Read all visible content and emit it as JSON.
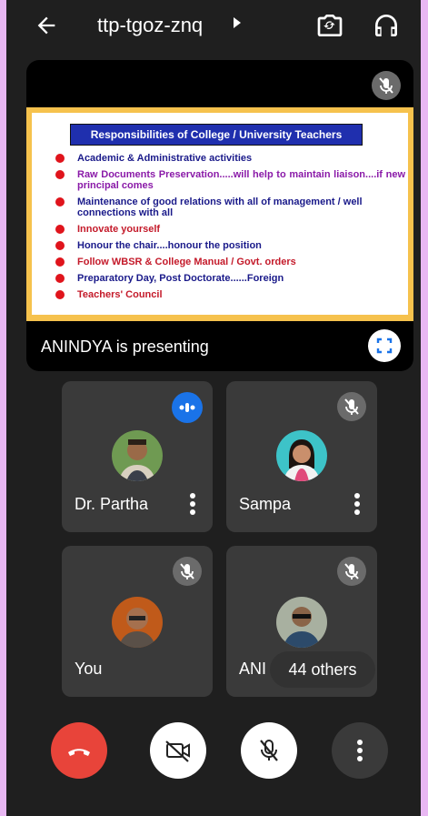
{
  "header": {
    "meeting_code": "ttp-tgoz-znq",
    "icons": [
      "back-arrow-icon",
      "chevron-right-icon",
      "switch-camera-icon",
      "headphones-icon"
    ]
  },
  "presentation": {
    "label": "ANINDYA is presenting",
    "slide": {
      "title": "Responsibilities of College / University Teachers",
      "items": [
        {
          "text": "Academic & Administrative activities",
          "color": "#1a1a8a"
        },
        {
          "text": "Raw   Documents   Preservation.....will   help   to   maintain liaison....if new principal comes",
          "color": "#8a1aa8"
        },
        {
          "text": "Maintenance of good relations with all of management / well connections with all",
          "color": "#1a1a8a"
        },
        {
          "text": "Innovate yourself",
          "color": "#c41a2a"
        },
        {
          "text": "Honour the chair....honour the position",
          "color": "#1a1a8a"
        },
        {
          "text": "Follow WBSR & College Manual / Govt. orders",
          "color": "#c41a2a"
        },
        {
          "text": "Preparatory Day, Post Doctorate......Foreign",
          "color": "#1a1a8a"
        },
        {
          "text": "Teachers' Council",
          "color": "#c41a2a"
        }
      ]
    }
  },
  "participants": [
    {
      "name": "Dr. Partha",
      "status": "speaking"
    },
    {
      "name": "Sampa",
      "status": "muted"
    },
    {
      "name": "You",
      "status": "muted"
    },
    {
      "name": "ANI",
      "status": "muted"
    }
  ],
  "others_chip": "44 others",
  "colors": {
    "background": "#1f1f1f",
    "tile": "#3a3a3a",
    "end_call": "#e8443a",
    "speaking_accent": "#1a73e8",
    "frame": "#e8b7f2"
  }
}
